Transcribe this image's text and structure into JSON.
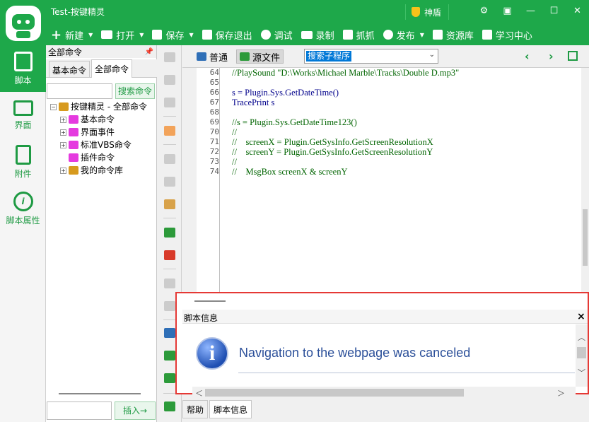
{
  "window": {
    "title": "Test-按键精灵",
    "shield_label": "神盾",
    "controls": [
      "gear-icon",
      "tray-icon",
      "minimize-icon",
      "maximize-icon",
      "close-icon"
    ]
  },
  "toolbar": {
    "new": "新建",
    "open": "打开",
    "save": "保存",
    "save_exit": "保存退出",
    "debug": "调试",
    "record": "录制",
    "capture": "抓抓",
    "publish": "发布",
    "resources": "资源库",
    "learning": "学习中心"
  },
  "leftnav": {
    "items": [
      {
        "label": "脚本",
        "icon": "script-icon",
        "active": true
      },
      {
        "label": "界面",
        "icon": "ui-grid-icon",
        "active": false
      },
      {
        "label": "附件",
        "icon": "attachment-icon",
        "active": false
      },
      {
        "label": "脚本属性",
        "icon": "info-icon",
        "active": false
      }
    ]
  },
  "commands": {
    "header": "全部命令",
    "pin": "ᵖ",
    "tabs": [
      "基本命令",
      "全部命令"
    ],
    "search_button": "搜索命令",
    "tree": [
      {
        "label": "按键精灵 - 全部命令",
        "level": 0,
        "expander": "−",
        "color": "#d79a1e"
      },
      {
        "label": "基本命令",
        "level": 1,
        "expander": "+",
        "color": "#e53adf"
      },
      {
        "label": "界面事件",
        "level": 1,
        "expander": "+",
        "color": "#e53adf"
      },
      {
        "label": "标准VBS命令",
        "level": 1,
        "expander": "+",
        "color": "#e53adf"
      },
      {
        "label": "插件命令",
        "level": 1,
        "expander": "",
        "color": "#e53adf"
      },
      {
        "label": "我的命令库",
        "level": 1,
        "expander": "+",
        "color": "#d79a1e"
      }
    ],
    "insert_button": "插入→"
  },
  "editor": {
    "mode_normal": "普通",
    "mode_source": "源文件",
    "subroutine_select": "搜索子程序",
    "line_numbers": [
      "64",
      "65",
      "66",
      "67",
      "68",
      "69",
      "70",
      "71",
      "72",
      "73",
      "74"
    ],
    "code_lines": [
      "//PlaySound \"D:\\Works\\Michael Marble\\Tracks\\Double D.mp3\"",
      "",
      "s = Plugin.Sys.GetDateTime()",
      "TracePrint s",
      "",
      "//s = Plugin.Sys.GetDateTime123()",
      "//",
      "//    screenX = Plugin.GetSysInfo.GetScreenResolutionX",
      "//    screenY = Plugin.GetSysInfo.GetScreenResolutionY",
      "//",
      "//    MsgBox screenX & screenY"
    ]
  },
  "info_panel": {
    "title": "脚本信息",
    "close": "×",
    "message": "Navigation to the webpage was canceled"
  },
  "bottom_tabs": [
    "帮助",
    "脚本信息"
  ],
  "colors": {
    "brand": "#1ea84a",
    "highlight_border": "#e53935",
    "message_text": "#2b4f99"
  }
}
